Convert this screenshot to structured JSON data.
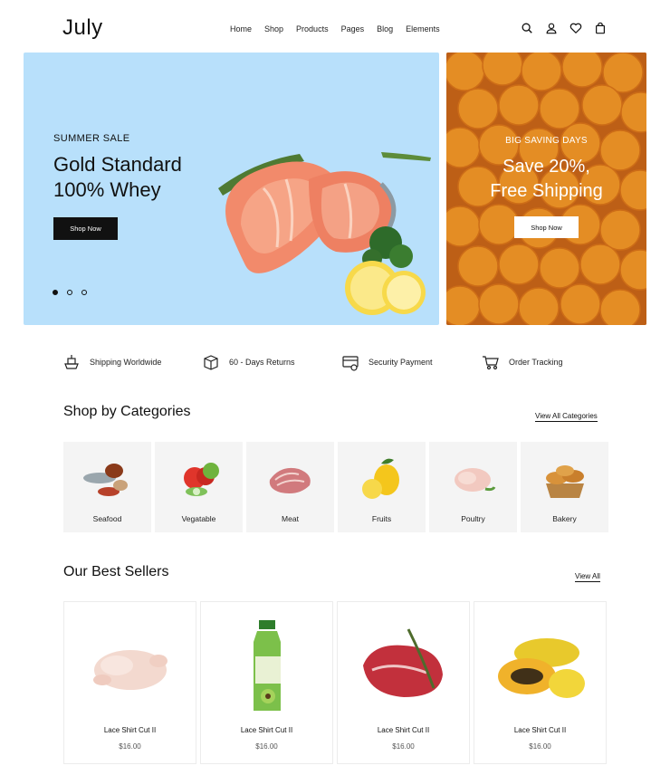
{
  "header": {
    "logo": "July",
    "nav": [
      "Home",
      "Shop",
      "Products",
      "Pages",
      "Blog",
      "Elements"
    ],
    "icons": [
      "search-icon",
      "user-icon",
      "heart-icon",
      "bag-icon"
    ]
  },
  "hero": {
    "kicker": "SUMMER SALE",
    "title_line1": "Gold Standard",
    "title_line2": "100% Whey",
    "button": "Shop Now",
    "slides": 3,
    "active_slide": 1
  },
  "side_banner": {
    "kicker": "BIG SAVING DAYS",
    "title_line1": "Save 20%,",
    "title_line2": "Free Shipping",
    "button": "Shop Now"
  },
  "features": [
    {
      "icon": "ship-icon",
      "label": "Shipping Worldwide"
    },
    {
      "icon": "box-return-icon",
      "label": "60 - Days Returns"
    },
    {
      "icon": "card-icon",
      "label": "Security Payment"
    },
    {
      "icon": "truck-icon",
      "label": "Order Tracking"
    }
  ],
  "categories": {
    "title": "Shop by Categories",
    "link": "View All Categories",
    "items": [
      "Seafood",
      "Vegatable",
      "Meat",
      "Fruits",
      "Poultry",
      "Bakery"
    ]
  },
  "best_sellers": {
    "title": "Our Best Sellers",
    "link": "View All",
    "items": [
      {
        "name": "Lace Shirt Cut II",
        "price": "$16.00"
      },
      {
        "name": "Lace Shirt Cut II",
        "price": "$16.00"
      },
      {
        "name": "Lace Shirt Cut II",
        "price": "$16.00"
      },
      {
        "name": "Lace Shirt Cut II",
        "price": "$16.00"
      }
    ]
  },
  "colors": {
    "hero_bg": "#b8e0fb",
    "orange": "#f08c22",
    "dark": "#111111"
  }
}
